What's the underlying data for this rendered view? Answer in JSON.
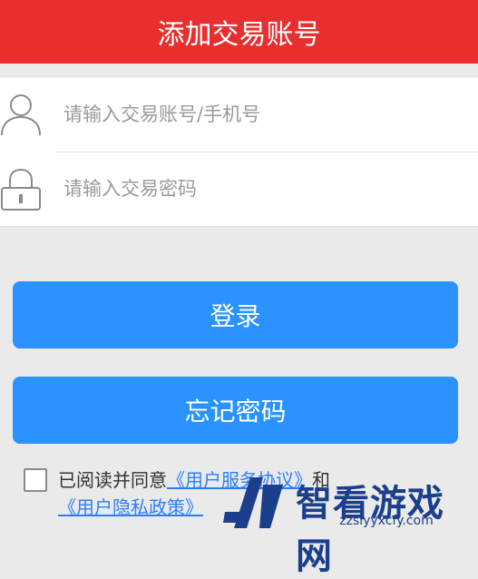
{
  "header": {
    "title": "添加交易账号"
  },
  "form": {
    "account_placeholder": "请输入交易账号/手机号",
    "account_value": "",
    "password_placeholder": "请输入交易密码",
    "password_value": ""
  },
  "buttons": {
    "login_label": "登录",
    "forgot_label": "忘记密码"
  },
  "agreement": {
    "checked": false,
    "prefix": "已阅读并同意",
    "link1": "《用户服务协议》",
    "and": "和",
    "link2": "《用户隐私政策》"
  },
  "watermark": {
    "name": "智看游戏网",
    "url": "zzslyyxcfy.com"
  },
  "colors": {
    "header_bg": "#e82e2e",
    "button_bg": "#2a93ff",
    "link": "#2a7fff",
    "page_bg": "#eaeaea"
  },
  "icons": {
    "account": "user-icon",
    "password": "lock-icon",
    "watermark": "logo-icon"
  }
}
